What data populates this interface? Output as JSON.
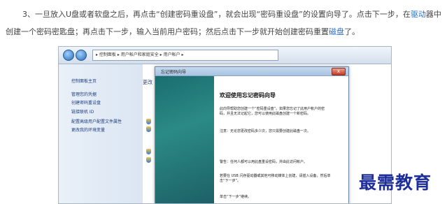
{
  "article": {
    "prefix": "3、一旦放入U盘或者软盘之后，再点击“创建密码重设盘”，就会出现“密码重设盘”的设置向导了。点击下一步，在",
    "link1": "驱动",
    "middle": "器中创建一个密码密匙盘；再点击下一步，输入当前用户密码；然后点击下一步就开始创建密码重置",
    "link2": "磁盘",
    "suffix": "了。"
  },
  "explorer": {
    "address": "▸ 控制面板 ▸ 用户帐户和家庭安全 ▸ 用户帐户 ▸",
    "sidebar_items": [
      "控制面板主页",
      "管理您的凭据",
      "创建密码重设盘",
      "链接联机 ID",
      "配置高级用户配置文件属性",
      "更改我的环境变量"
    ],
    "right_link": "更改"
  },
  "dialog": {
    "title": "忘记密码向导",
    "close_label": "x",
    "heading": "欢迎使用忘记密码向导",
    "paragraphs": [
      "此向导帮助您创建一个“密码重设盘”。如果您忘记了此用户帐户的密码，并且无法记起它，您可以使用此磁盘创建一个新密码。",
      "注意：无论您更改密码多少次，您只需要创建此磁盘一次。",
      "警告：任何人都可以用此盘重设密码，并由此访问帐户。",
      "若要在 USB 闪存驱动器或其他可移动媒体上创建，请插入设备，然后单击“下一步”。",
      "单击“下一步”继续。"
    ]
  },
  "watermark": "最需教育"
}
